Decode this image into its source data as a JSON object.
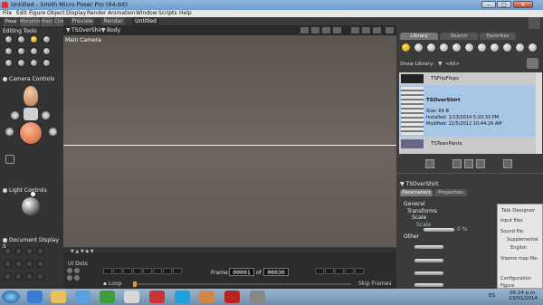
{
  "window": {
    "title": "Untitled - Smith Micro Poser Pro (64-bit)",
    "minimize": "–",
    "maximize": "□",
    "close": "✕"
  },
  "menu": [
    "File",
    "Edit",
    "Figure",
    "Object",
    "Display",
    "Render",
    "Animation",
    "Window",
    "Scripts",
    "Help"
  ],
  "left": {
    "tabs": [
      "Pose",
      "Morphing",
      "Hair",
      "Cloth",
      "Setup",
      "Face"
    ],
    "editing_tools": "Editing Tools",
    "camera_controls": "Camera Controls",
    "light_controls": "Light Controls",
    "document_display": "Document Display S"
  },
  "viewport": {
    "tabs": [
      "Preview",
      "Render",
      "Untitled"
    ],
    "figure": "TSOverShirt",
    "part": "Body",
    "camera": "Main Camera"
  },
  "timeline": {
    "ui_dots": "UI Dots",
    "frame_label": "Frame:",
    "frame": "00001",
    "of": "of",
    "total": "00030",
    "loop": "Loop",
    "skip_frames": "Skip Frames"
  },
  "library": {
    "tabs": [
      "Library",
      "Search",
      "Favorites"
    ],
    "show_library_label": "Show Library:",
    "show_library_value": "<All>",
    "items": [
      {
        "name": "TSFlipFlops"
      },
      {
        "name": "TSOverShirt",
        "size": "Size: 64 B",
        "installed": "Installed: 1/13/2014 5:20:33 PM",
        "modified": "Modified: 12/5/2012 10:44:26 AM"
      },
      {
        "name": "TSTeenPants"
      }
    ]
  },
  "properties": {
    "title": "TSOverShirt",
    "tabs": [
      "Parameters",
      "Properties"
    ],
    "groups": [
      "General",
      "Transforms",
      "Scale",
      "Scale",
      "Other"
    ],
    "scale_value": "0 %"
  },
  "talk_designer": {
    "title": "Talk Designer",
    "input_files": "Input files",
    "sound_file": "Sound file:",
    "supplemental": "Supplemental",
    "english": "English",
    "viseme_map_file": "Viseme map file:",
    "configuration": "Configuration",
    "figure": "Figure"
  },
  "taskbar": {
    "lang": "ES",
    "time": "06:24 p.m.",
    "date": "13/01/2014"
  }
}
